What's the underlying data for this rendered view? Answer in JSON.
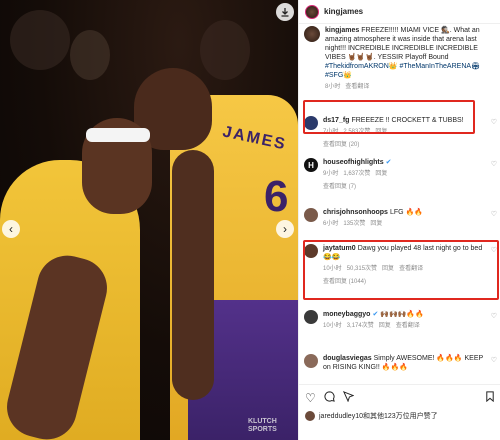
{
  "photo": {
    "jersey_name": "JAMES",
    "jersey_number": "6",
    "watermark": "KLUTCH\nSPORTS",
    "download_icon": "download-icon",
    "prev_icon": "chevron-left-icon",
    "next_icon": "chevron-right-icon"
  },
  "header": {
    "username": "kingjames"
  },
  "caption": {
    "username": "kingjames",
    "text": "FREEZE!!!!! MIAMI VICE 🕵🏾. What an amazing atmosphere it was inside that arena last night!!! INCREDIBLE INCREDIBLE INCREDIBLE VIBES 🤘🏾🤘🏾🤘🏾. YESSIR Playoff Bound ",
    "hashtags": "#ThekidfromAKRON👑 #TheManInTheARENA🏟 #SFG👑",
    "time": "8小时",
    "translate": "查看翻译"
  },
  "comments": [
    {
      "username": "ds17_fg",
      "text": "FREEEZE !! CROCKETT & TUBBS!",
      "time": "7小时",
      "likes": "2,583次赞",
      "reply": "回复",
      "replies": "查看回复 (20)"
    },
    {
      "username": "houseofhighlights",
      "text": "",
      "time": "9小时",
      "likes": "1,637次赞",
      "reply": "回复",
      "replies": "查看回复 (7)"
    },
    {
      "username": "chrisjohnsonhoops",
      "text": "LFG 🔥🔥",
      "time": "6小时",
      "likes": "135次赞",
      "reply": "回复",
      "replies": ""
    },
    {
      "username": "jaytatum0",
      "text": "Dawg you played 48 last night go to bed 😂😂",
      "time": "10小时",
      "likes": "50,315次赞",
      "reply": "回复",
      "translate": "查看翻译",
      "replies": "查看回复 (1044)"
    },
    {
      "username": "moneybaggyo",
      "text": "🙌🏾🙌🏾🙌🏾🔥🔥",
      "time": "10小时",
      "likes": "3,174次赞",
      "reply": "回复",
      "translate": "查看翻译",
      "replies": ""
    },
    {
      "username": "douglasviegas",
      "text": "Simply AWESOME! 🔥🔥🔥 KEEP on RISING KING!! 🔥🔥🔥",
      "time": "",
      "likes": "",
      "reply": "",
      "replies": ""
    }
  ],
  "footer": {
    "liked_by": "jareddudley10和其他123万位用户赞了"
  },
  "colors": {
    "highlight": "#e0281f",
    "lakers_gold": "#f2c53a",
    "lakers_purple": "#3b2268",
    "link": "#00376b"
  }
}
